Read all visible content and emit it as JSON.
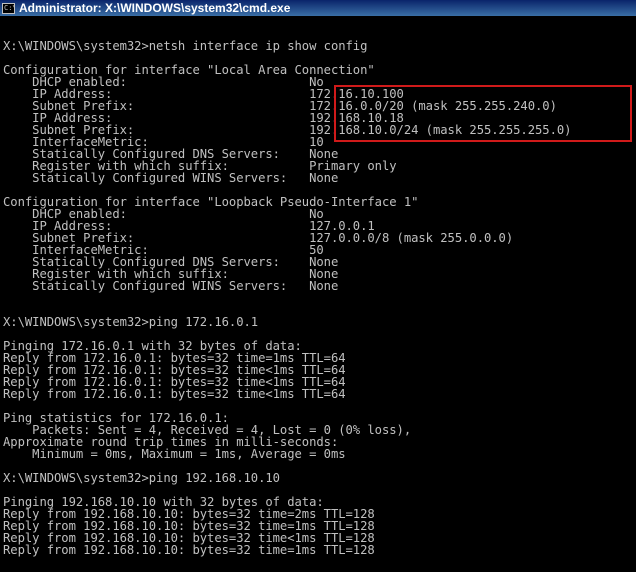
{
  "window": {
    "title": "Administrator: X:\\WINDOWS\\system32\\cmd.exe",
    "icon_label": "C:\\"
  },
  "colors": {
    "titlebar": "#0a246a",
    "console_bg": "#000000",
    "console_fg": "#c0c0c0",
    "highlight": "#d01a1a"
  },
  "console": {
    "lines": [
      "",
      "",
      "X:\\WINDOWS\\system32>netsh interface ip show config",
      "",
      "Configuration for interface \"Local Area Connection\"",
      "    DHCP enabled:                         No",
      "    IP Address:                           172.16.10.100",
      "    Subnet Prefix:                        172.16.0.0/20 (mask 255.255.240.0)",
      "    IP Address:                           192.168.10.18",
      "    Subnet Prefix:                        192.168.10.0/24 (mask 255.255.255.0)",
      "    InterfaceMetric:                      10",
      "    Statically Configured DNS Servers:    None",
      "    Register with which suffix:           Primary only",
      "    Statically Configured WINS Servers:   None",
      "",
      "Configuration for interface \"Loopback Pseudo-Interface 1\"",
      "    DHCP enabled:                         No",
      "    IP Address:                           127.0.0.1",
      "    Subnet Prefix:                        127.0.0.0/8 (mask 255.0.0.0)",
      "    InterfaceMetric:                      50",
      "    Statically Configured DNS Servers:    None",
      "    Register with which suffix:           None",
      "    Statically Configured WINS Servers:   None",
      "",
      "",
      "X:\\WINDOWS\\system32>ping 172.16.0.1",
      "",
      "Pinging 172.16.0.1 with 32 bytes of data:",
      "Reply from 172.16.0.1: bytes=32 time=1ms TTL=64",
      "Reply from 172.16.0.1: bytes=32 time<1ms TTL=64",
      "Reply from 172.16.0.1: bytes=32 time<1ms TTL=64",
      "Reply from 172.16.0.1: bytes=32 time<1ms TTL=64",
      "",
      "Ping statistics for 172.16.0.1:",
      "    Packets: Sent = 4, Received = 4, Lost = 0 (0% loss),",
      "Approximate round trip times in milli-seconds:",
      "    Minimum = 0ms, Maximum = 1ms, Average = 0ms",
      "",
      "X:\\WINDOWS\\system32>ping 192.168.10.10",
      "",
      "Pinging 192.168.10.10 with 32 bytes of data:",
      "Reply from 192.168.10.10: bytes=32 time=2ms TTL=128",
      "Reply from 192.168.10.10: bytes=32 time=1ms TTL=128",
      "Reply from 192.168.10.10: bytes=32 time<1ms TTL=128",
      "Reply from 192.168.10.10: bytes=32 time=1ms TTL=128"
    ]
  }
}
